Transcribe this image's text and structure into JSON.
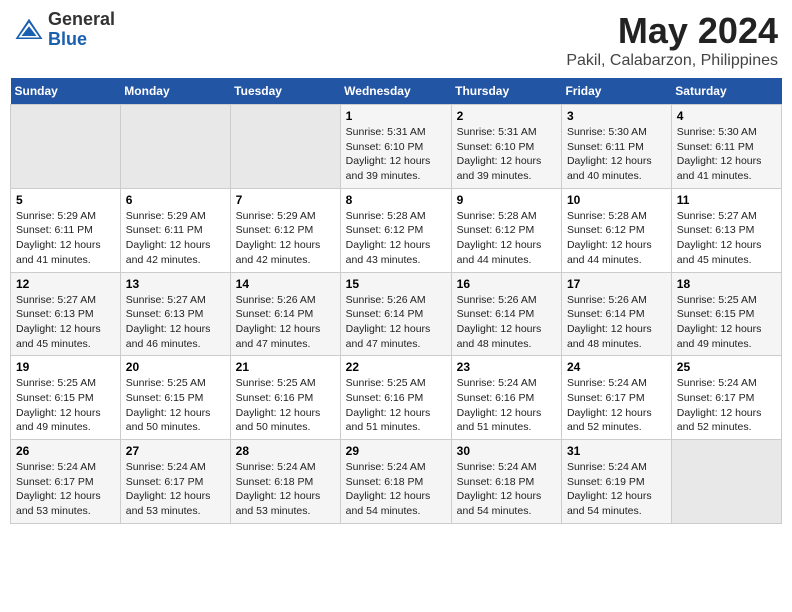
{
  "logo": {
    "general": "General",
    "blue": "Blue"
  },
  "title": "May 2024",
  "subtitle": "Pakil, Calabarzon, Philippines",
  "days_of_week": [
    "Sunday",
    "Monday",
    "Tuesday",
    "Wednesday",
    "Thursday",
    "Friday",
    "Saturday"
  ],
  "weeks": [
    [
      {
        "day": "",
        "info": ""
      },
      {
        "day": "",
        "info": ""
      },
      {
        "day": "",
        "info": ""
      },
      {
        "day": "1",
        "info": "Sunrise: 5:31 AM\nSunset: 6:10 PM\nDaylight: 12 hours and 39 minutes."
      },
      {
        "day": "2",
        "info": "Sunrise: 5:31 AM\nSunset: 6:10 PM\nDaylight: 12 hours and 39 minutes."
      },
      {
        "day": "3",
        "info": "Sunrise: 5:30 AM\nSunset: 6:11 PM\nDaylight: 12 hours and 40 minutes."
      },
      {
        "day": "4",
        "info": "Sunrise: 5:30 AM\nSunset: 6:11 PM\nDaylight: 12 hours and 41 minutes."
      }
    ],
    [
      {
        "day": "5",
        "info": "Sunrise: 5:29 AM\nSunset: 6:11 PM\nDaylight: 12 hours and 41 minutes."
      },
      {
        "day": "6",
        "info": "Sunrise: 5:29 AM\nSunset: 6:11 PM\nDaylight: 12 hours and 42 minutes."
      },
      {
        "day": "7",
        "info": "Sunrise: 5:29 AM\nSunset: 6:12 PM\nDaylight: 12 hours and 42 minutes."
      },
      {
        "day": "8",
        "info": "Sunrise: 5:28 AM\nSunset: 6:12 PM\nDaylight: 12 hours and 43 minutes."
      },
      {
        "day": "9",
        "info": "Sunrise: 5:28 AM\nSunset: 6:12 PM\nDaylight: 12 hours and 44 minutes."
      },
      {
        "day": "10",
        "info": "Sunrise: 5:28 AM\nSunset: 6:12 PM\nDaylight: 12 hours and 44 minutes."
      },
      {
        "day": "11",
        "info": "Sunrise: 5:27 AM\nSunset: 6:13 PM\nDaylight: 12 hours and 45 minutes."
      }
    ],
    [
      {
        "day": "12",
        "info": "Sunrise: 5:27 AM\nSunset: 6:13 PM\nDaylight: 12 hours and 45 minutes."
      },
      {
        "day": "13",
        "info": "Sunrise: 5:27 AM\nSunset: 6:13 PM\nDaylight: 12 hours and 46 minutes."
      },
      {
        "day": "14",
        "info": "Sunrise: 5:26 AM\nSunset: 6:14 PM\nDaylight: 12 hours and 47 minutes."
      },
      {
        "day": "15",
        "info": "Sunrise: 5:26 AM\nSunset: 6:14 PM\nDaylight: 12 hours and 47 minutes."
      },
      {
        "day": "16",
        "info": "Sunrise: 5:26 AM\nSunset: 6:14 PM\nDaylight: 12 hours and 48 minutes."
      },
      {
        "day": "17",
        "info": "Sunrise: 5:26 AM\nSunset: 6:14 PM\nDaylight: 12 hours and 48 minutes."
      },
      {
        "day": "18",
        "info": "Sunrise: 5:25 AM\nSunset: 6:15 PM\nDaylight: 12 hours and 49 minutes."
      }
    ],
    [
      {
        "day": "19",
        "info": "Sunrise: 5:25 AM\nSunset: 6:15 PM\nDaylight: 12 hours and 49 minutes."
      },
      {
        "day": "20",
        "info": "Sunrise: 5:25 AM\nSunset: 6:15 PM\nDaylight: 12 hours and 50 minutes."
      },
      {
        "day": "21",
        "info": "Sunrise: 5:25 AM\nSunset: 6:16 PM\nDaylight: 12 hours and 50 minutes."
      },
      {
        "day": "22",
        "info": "Sunrise: 5:25 AM\nSunset: 6:16 PM\nDaylight: 12 hours and 51 minutes."
      },
      {
        "day": "23",
        "info": "Sunrise: 5:24 AM\nSunset: 6:16 PM\nDaylight: 12 hours and 51 minutes."
      },
      {
        "day": "24",
        "info": "Sunrise: 5:24 AM\nSunset: 6:17 PM\nDaylight: 12 hours and 52 minutes."
      },
      {
        "day": "25",
        "info": "Sunrise: 5:24 AM\nSunset: 6:17 PM\nDaylight: 12 hours and 52 minutes."
      }
    ],
    [
      {
        "day": "26",
        "info": "Sunrise: 5:24 AM\nSunset: 6:17 PM\nDaylight: 12 hours and 53 minutes."
      },
      {
        "day": "27",
        "info": "Sunrise: 5:24 AM\nSunset: 6:17 PM\nDaylight: 12 hours and 53 minutes."
      },
      {
        "day": "28",
        "info": "Sunrise: 5:24 AM\nSunset: 6:18 PM\nDaylight: 12 hours and 53 minutes."
      },
      {
        "day": "29",
        "info": "Sunrise: 5:24 AM\nSunset: 6:18 PM\nDaylight: 12 hours and 54 minutes."
      },
      {
        "day": "30",
        "info": "Sunrise: 5:24 AM\nSunset: 6:18 PM\nDaylight: 12 hours and 54 minutes."
      },
      {
        "day": "31",
        "info": "Sunrise: 5:24 AM\nSunset: 6:19 PM\nDaylight: 12 hours and 54 minutes."
      },
      {
        "day": "",
        "info": ""
      }
    ]
  ]
}
